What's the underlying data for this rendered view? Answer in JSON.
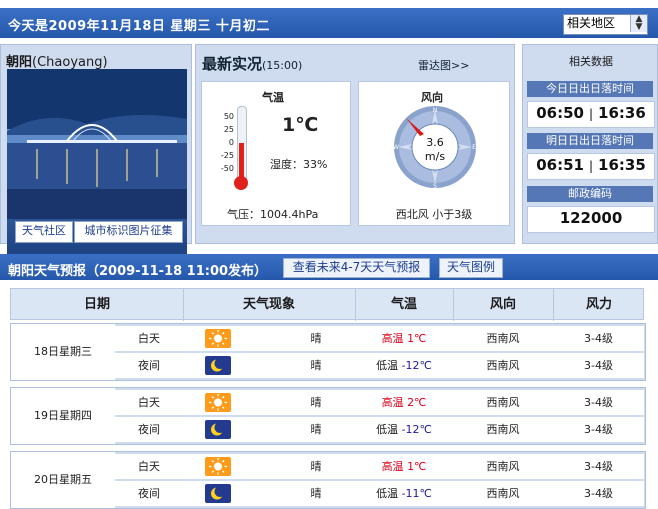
{
  "top": {
    "date_text": "今天是2009年11月18日  星期三  十月初二",
    "region_select": "相关地区"
  },
  "city": {
    "name": "朝阳",
    "name_en": "(Chaoyang)",
    "buttons": [
      "天气社区",
      "城市标识图片征集"
    ]
  },
  "now": {
    "title": "最新实况",
    "time": "(15:00)",
    "radar_link": "雷达图>>",
    "temp_label": "气温",
    "temp_value": "1℃",
    "humidity": "湿度：33%",
    "pressure": "气压：1004.4hPa",
    "thermo_ticks": [
      "50",
      "25",
      "0",
      "-25",
      "-50"
    ],
    "thermo_level": 0.5,
    "wind_label": "风向",
    "wind_speed": "3.6",
    "wind_unit": "m/s",
    "wind_desc": "西北风  小于3级",
    "compass": [
      "N",
      "E",
      "S",
      "W"
    ]
  },
  "related": {
    "title": "相关数据",
    "sun_today_label": "今日日出日落时间",
    "sun_today_rise": "06:50",
    "sun_today_set": "16:36",
    "sun_tomorrow_label": "明日日出日落时间",
    "sun_tomorrow_rise": "06:51",
    "sun_tomorrow_set": "16:35",
    "postcode_label": "邮政编码",
    "postcode": "122000"
  },
  "forecast": {
    "title": "朝阳天气预报（2009-11-18 11:00发布）",
    "btn_future": "查看未来4-7天天气预报",
    "btn_legend": "天气图例",
    "headers": [
      "日期",
      "天气现象",
      "气温",
      "风向",
      "风力"
    ],
    "days": [
      {
        "date": "18日星期三",
        "day": {
          "label": "白天",
          "icon": "sun-icon",
          "weather": "晴",
          "temp_label": "高温",
          "temp": "1℃",
          "wind_dir": "西南风",
          "wind_force": "3-4级"
        },
        "night": {
          "label": "夜间",
          "icon": "moon-icon",
          "weather": "晴",
          "temp_label": "低温",
          "temp": "-12℃",
          "wind_dir": "西南风",
          "wind_force": "3-4级"
        }
      },
      {
        "date": "19日星期四",
        "day": {
          "label": "白天",
          "icon": "sun-icon",
          "weather": "晴",
          "temp_label": "高温",
          "temp": "2℃",
          "wind_dir": "西南风",
          "wind_force": "3-4级"
        },
        "night": {
          "label": "夜间",
          "icon": "moon-icon",
          "weather": "晴",
          "temp_label": "低温",
          "temp": "-12℃",
          "wind_dir": "西南风",
          "wind_force": "3-4级"
        }
      },
      {
        "date": "20日星期五",
        "day": {
          "label": "白天",
          "icon": "sun-icon",
          "weather": "晴",
          "temp_label": "高温",
          "temp": "1℃",
          "wind_dir": "西南风",
          "wind_force": "3-4级"
        },
        "night": {
          "label": "夜间",
          "icon": "moon-icon",
          "weather": "晴",
          "temp_label": "低温",
          "temp": "-11℃",
          "wind_dir": "西南风",
          "wind_force": "3-4级"
        }
      }
    ]
  }
}
